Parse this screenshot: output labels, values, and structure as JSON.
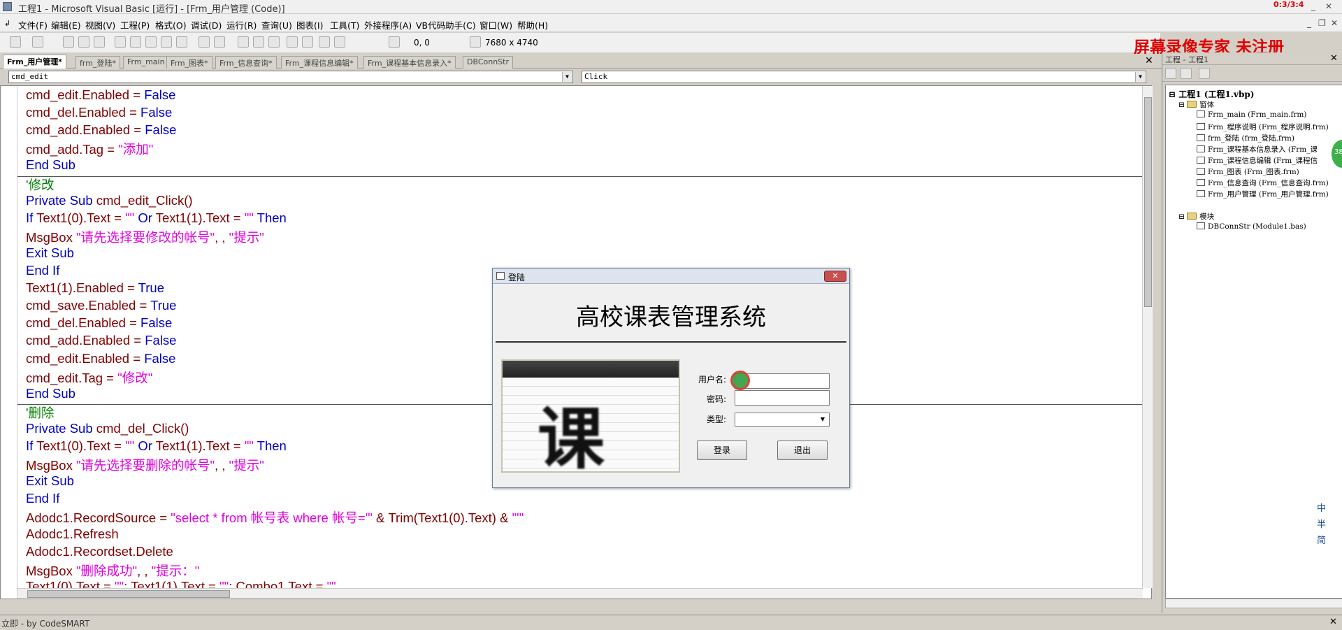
{
  "window": {
    "title": "工程1 - Microsoft Visual Basic [运行] - [Frm_用户管理 (Code)]",
    "recorder_timer": "0:3/3:4"
  },
  "menu": [
    "文件(F)",
    "编辑(E)",
    "视图(V)",
    "工程(P)",
    "格式(O)",
    "调试(D)",
    "运行(R)",
    "查询(U)",
    "图表(I)",
    "工具(T)",
    "外接程序(A)",
    "VB代码助手(C)",
    "窗口(W)",
    "帮助(H)"
  ],
  "toolbar": {
    "position": "0, 0",
    "size": "7680 x 4740"
  },
  "watermark": "屏幕录像专家  未注册",
  "tabs": [
    "Frm_用户管理*",
    "frm_登陆*",
    "Frm_main",
    "Frm_图表*",
    "Frm_信息查询*",
    "Frm_课程信息编辑*",
    "Frm_课程基本信息录入*",
    "DBConnStr"
  ],
  "object_combo": "cmd_edit",
  "proc_combo": "Click",
  "code_lines": [
    [
      [
        "p",
        "cmd_edit.Enabled = "
      ],
      [
        "k",
        "False"
      ]
    ],
    [
      [
        "p",
        "cmd_del.Enabled = "
      ],
      [
        "k",
        "False"
      ]
    ],
    [
      [
        "p",
        "cmd_add.Enabled = "
      ],
      [
        "k",
        "False"
      ]
    ],
    [
      [
        "p",
        "cmd_add.Tag = "
      ],
      [
        "s",
        "\"添加\""
      ]
    ],
    [
      [
        "k",
        "End Sub"
      ]
    ],
    [
      [
        "c",
        "'修改"
      ]
    ],
    [
      [
        "k",
        "Private Sub "
      ],
      [
        "p",
        "cmd_edit_Click()"
      ]
    ],
    [
      [
        "k",
        "If "
      ],
      [
        "p",
        "Text1(0).Text = "
      ],
      [
        "s",
        "\"\""
      ],
      [
        "k",
        " Or "
      ],
      [
        "p",
        "Text1(1).Text = "
      ],
      [
        "s",
        "\"\""
      ],
      [
        "k",
        " Then"
      ]
    ],
    [
      [
        "p",
        "MsgBox "
      ],
      [
        "s",
        "\"请先选择要修改的帐号\""
      ],
      [
        "p",
        ", , "
      ],
      [
        "s",
        "\"提示\""
      ]
    ],
    [
      [
        "k",
        "Exit Sub"
      ]
    ],
    [
      [
        "k",
        "End If"
      ]
    ],
    [
      [
        "p",
        "Text1(1).Enabled = "
      ],
      [
        "k",
        "True"
      ]
    ],
    [
      [
        "p",
        "cmd_save.Enabled = "
      ],
      [
        "k",
        "True"
      ]
    ],
    [
      [
        "p",
        "cmd_del.Enabled = "
      ],
      [
        "k",
        "False"
      ]
    ],
    [
      [
        "p",
        "cmd_add.Enabled = "
      ],
      [
        "k",
        "False"
      ]
    ],
    [
      [
        "p",
        "cmd_edit.Enabled = "
      ],
      [
        "k",
        "False"
      ]
    ],
    [
      [
        "p",
        "cmd_edit.Tag = "
      ],
      [
        "s",
        "\"修改\""
      ]
    ],
    [
      [
        "k",
        "End Sub"
      ]
    ],
    [
      [
        "c",
        "'删除"
      ]
    ],
    [
      [
        "k",
        "Private Sub "
      ],
      [
        "p",
        "cmd_del_Click()"
      ]
    ],
    [
      [
        "k",
        "If "
      ],
      [
        "p",
        "Text1(0).Text = "
      ],
      [
        "s",
        "\"\""
      ],
      [
        "k",
        " Or "
      ],
      [
        "p",
        "Text1(1).Text = "
      ],
      [
        "s",
        "\"\""
      ],
      [
        "k",
        " Then"
      ]
    ],
    [
      [
        "p",
        "MsgBox "
      ],
      [
        "s",
        "\"请先选择要删除的帐号\""
      ],
      [
        "p",
        ", , "
      ],
      [
        "s",
        "\"提示\""
      ]
    ],
    [
      [
        "k",
        "Exit Sub"
      ]
    ],
    [
      [
        "k",
        "End If"
      ]
    ],
    [
      [
        "p",
        "Adodc1.RecordSource = "
      ],
      [
        "s",
        "\"select * from 帐号表 where 帐号='\""
      ],
      [
        "p",
        " & Trim(Text1(0).Text) & "
      ],
      [
        "s",
        "\"'\""
      ]
    ],
    [
      [
        "p",
        "Adodc1.Refresh"
      ]
    ],
    [
      [
        "p",
        "Adodc1.Recordset.Delete"
      ]
    ],
    [
      [
        "p",
        "MsgBox "
      ],
      [
        "s",
        "\"删除成功\""
      ],
      [
        "p",
        ", , "
      ],
      [
        "s",
        "\"提示：\""
      ]
    ],
    [
      [
        "p",
        "Text1(0).Text = "
      ],
      [
        "s",
        "\"\""
      ],
      [
        "p",
        ": Text1(1).Text = "
      ],
      [
        "s",
        "\"\""
      ],
      [
        "p",
        ": Combo1.Text = "
      ],
      [
        "s",
        "\"\""
      ]
    ]
  ],
  "project": {
    "title": "工程 - 工程1",
    "root": "工程1 (工程1.vbp)",
    "forms_folder": "窗体",
    "forms": [
      "Frm_main (Frm_main.frm)",
      "Frm_程序说明 (Frm_程序说明.frm)",
      "frm_登陆 (frm_登陆.frm)",
      "Frm_课程基本信息录入 (Frm_课",
      "Frm_课程信息编辑 (Frm_课程信",
      "Frm_图表 (Frm_图表.frm)",
      "Frm_信息查询 (Frm_信息查询.frm)",
      "Frm_用户管理 (Frm_用户管理.frm)"
    ],
    "modules_folder": "模块",
    "modules": [
      "DBConnStr (Module1.bas)"
    ]
  },
  "ime": [
    "中",
    "半",
    "简"
  ],
  "status": "立即 - by CodeSMART",
  "green_badge": "38",
  "dialog": {
    "title": "登陆",
    "close": "✕",
    "heading": "高校课表管理系统",
    "image_glyph": "课",
    "username_label": "用户名:",
    "password_label": "密码:",
    "type_label": "类型:",
    "login_button": "登录",
    "exit_button": "退出"
  }
}
